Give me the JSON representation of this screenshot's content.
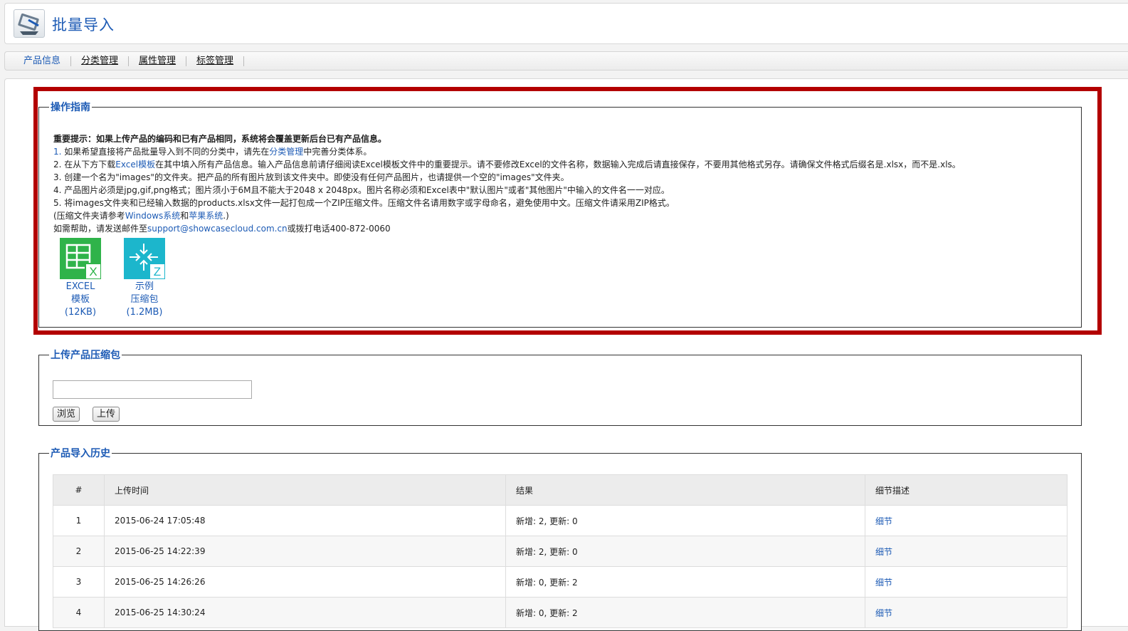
{
  "header": {
    "title": "批量导入",
    "icon": "import-icon"
  },
  "tabs": [
    {
      "label": "产品信息",
      "active": true
    },
    {
      "label": "分类管理",
      "active": false
    },
    {
      "label": "属性管理",
      "active": false
    },
    {
      "label": "标签管理",
      "active": false
    }
  ],
  "guide": {
    "legend": "操作指南",
    "important": "重要提示：如果上传产品的编码和已有产品相同，系统将会覆盖更新后台已有产品信息。",
    "steps": [
      {
        "num": "1.",
        "pre": "如果希望直接将产品批量导入到不同的分类中，请先在",
        "link": "分类管理",
        "post": "中完善分类体系。"
      },
      {
        "num": "2.",
        "pre": "在从下方下载",
        "link": "Excel模板",
        "post": "在其中填入所有产品信息。输入产品信息前请仔细阅读Excel模板文件中的重要提示。请不要修改Excel的文件名称，数据输入完成后请直接保存，不要用其他格式另存。请确保文件格式后缀名是.xlsx，而不是.xls。"
      },
      {
        "num": "3.",
        "text": "创建一个名为\"images\"的文件夹。把产品的所有图片放到该文件夹中。即使没有任何产品图片，也请提供一个空的\"images\"文件夹。"
      },
      {
        "num": "4.",
        "text": "产品图片必须是jpg,gif,png格式；图片须小于6M且不能大于2048 x 2048px。图片名称必须和Excel表中\"默认图片\"或者\"其他图片\"中输入的文件名一一对应。"
      },
      {
        "num": "5.",
        "text": "将images文件夹和已经输入数据的products.xlsx文件一起打包成一个ZIP压缩文件。压缩文件名请用数字或字母命名，避免使用中文。压缩文件请采用ZIP格式。"
      }
    ],
    "compress_note": {
      "pre": "(压缩文件夹请参考",
      "link1": "Windows系统",
      "mid": "和",
      "link2": "苹果系统",
      "post": ".)"
    },
    "help": {
      "pre": "如需帮助，请发送邮件至",
      "email": "support@showcasecloud.com.cn",
      "post": "或拨打电话400-872-0060"
    },
    "downloads": [
      {
        "icon": "excel-file-icon",
        "line1": "EXCEL",
        "line2": "模板",
        "line3": "(12KB)"
      },
      {
        "icon": "zip-file-icon",
        "line1": "示例",
        "line2": "压缩包",
        "line3": "(1.2MB)"
      }
    ]
  },
  "upload": {
    "legend": "上传产品压缩包",
    "file_value": "",
    "browse_label": "浏览",
    "upload_label": "上传"
  },
  "history": {
    "legend": "产品导入历史",
    "columns": [
      "#",
      "上传时间",
      "结果",
      "细节描述"
    ],
    "rows": [
      {
        "num": "1",
        "time": "2015-06-24 17:05:48",
        "result": "新增: 2, 更新: 0",
        "detail": "细节"
      },
      {
        "num": "2",
        "time": "2015-06-25 14:22:39",
        "result": "新增: 2, 更新: 0",
        "detail": "细节"
      },
      {
        "num": "3",
        "time": "2015-06-25 14:26:26",
        "result": "新增: 0, 更新: 2",
        "detail": "细节"
      },
      {
        "num": "4",
        "time": "2015-06-25 14:30:24",
        "result": "新增: 0, 更新: 2",
        "detail": "细节"
      }
    ]
  },
  "colors": {
    "accent": "#1d5bb5",
    "highlight": "#b30000",
    "excel": "#2fb34a",
    "zip": "#1cb6cc"
  }
}
